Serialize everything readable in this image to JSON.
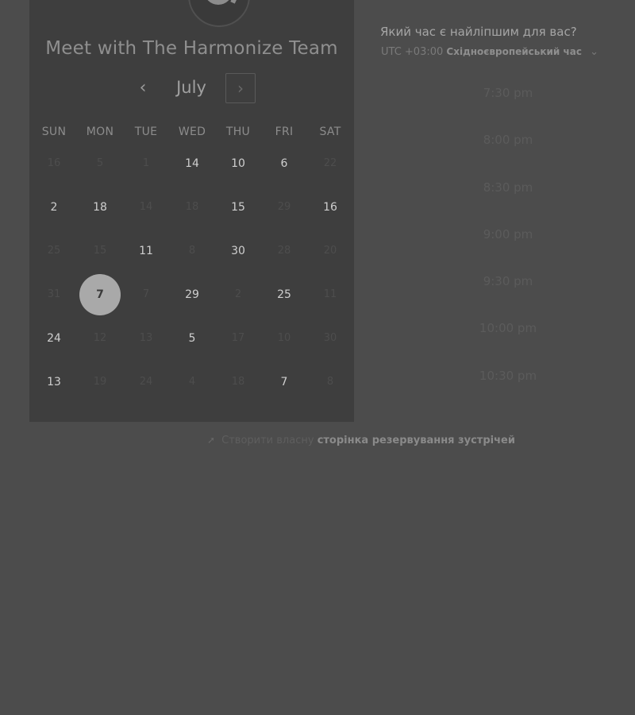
{
  "calendar": {
    "title": "Meet with The Harmonize Team",
    "month": "July",
    "prev_icon": "‹",
    "next_icon": "›",
    "weekdays": [
      "SUN",
      "MON",
      "TUE",
      "WED",
      "THU",
      "FRI",
      "SAT"
    ],
    "weeks": [
      [
        {
          "n": "16",
          "on": false
        },
        {
          "n": "5",
          "on": false
        },
        {
          "n": "1",
          "on": false
        },
        {
          "n": "14",
          "on": true
        },
        {
          "n": "10",
          "on": true
        },
        {
          "n": "6",
          "on": true
        },
        {
          "n": "22",
          "on": false
        }
      ],
      [
        {
          "n": "2",
          "on": true
        },
        {
          "n": "18",
          "on": true
        },
        {
          "n": "14",
          "on": false
        },
        {
          "n": "18",
          "on": false
        },
        {
          "n": "15",
          "on": true
        },
        {
          "n": "29",
          "on": false
        },
        {
          "n": "16",
          "on": true
        }
      ],
      [
        {
          "n": "25",
          "on": false
        },
        {
          "n": "15",
          "on": false
        },
        {
          "n": "11",
          "on": true
        },
        {
          "n": "8",
          "on": false
        },
        {
          "n": "30",
          "on": true
        },
        {
          "n": "28",
          "on": false
        },
        {
          "n": "20",
          "on": false
        }
      ],
      [
        {
          "n": "31",
          "on": false
        },
        {
          "n": "7",
          "on": true,
          "selected": true
        },
        {
          "n": "7",
          "on": false
        },
        {
          "n": "29",
          "on": true
        },
        {
          "n": "2",
          "on": false
        },
        {
          "n": "25",
          "on": true
        },
        {
          "n": "11",
          "on": false
        }
      ],
      [
        {
          "n": "24",
          "on": true
        },
        {
          "n": "12",
          "on": false
        },
        {
          "n": "13",
          "on": false
        },
        {
          "n": "5",
          "on": true
        },
        {
          "n": "17",
          "on": false
        },
        {
          "n": "10",
          "on": false
        },
        {
          "n": "30",
          "on": false
        }
      ],
      [
        {
          "n": "13",
          "on": true
        },
        {
          "n": "19",
          "on": false
        },
        {
          "n": "24",
          "on": false
        },
        {
          "n": "4",
          "on": false
        },
        {
          "n": "18",
          "on": false
        },
        {
          "n": "7",
          "on": true
        },
        {
          "n": "8",
          "on": false
        }
      ]
    ]
  },
  "times": {
    "question": "Який час є найліпшим для вас?",
    "tz_offset": "UTC +03:00",
    "tz_name": "Східноєвропейський час",
    "tz_caret": "⌄",
    "slots": [
      "7:30 pm",
      "8:00 pm",
      "8:30 pm",
      "9:00 pm",
      "9:30 pm",
      "10:00 pm",
      "10:30 pm"
    ]
  },
  "footer": {
    "icon": "pointer-icon",
    "lead": "Створити власну",
    "link": "сторінка резервування зустрічей"
  }
}
